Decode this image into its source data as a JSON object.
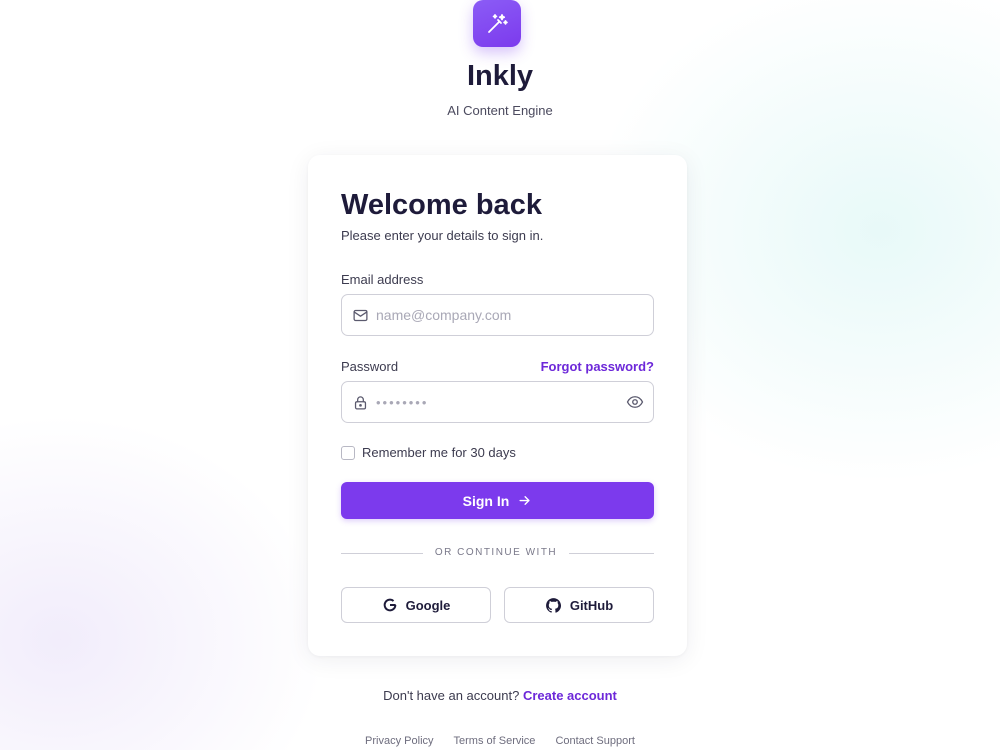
{
  "brand": {
    "name": "Inkly",
    "tagline": "AI Content Engine",
    "logo_icon": "magic-wand-sparkles-icon",
    "accent_color": "#7c3aed"
  },
  "card": {
    "title": "Welcome back",
    "subtitle": "Please enter your details to sign in.",
    "email": {
      "label": "Email address",
      "placeholder": "name@company.com",
      "value": "",
      "icon": "mail-icon"
    },
    "password": {
      "label": "Password",
      "placeholder": "••••••••",
      "value": "",
      "icon": "lock-icon",
      "toggle_icon": "eye-icon",
      "forgot_label": "Forgot password?"
    },
    "remember": {
      "label": "Remember me for 30 days",
      "checked": false
    },
    "submit_label": "Sign In",
    "divider_text": "OR CONTINUE WITH",
    "social": {
      "google_label": "Google",
      "github_label": "GitHub"
    }
  },
  "signup": {
    "prompt": "Don't have an account?",
    "link_label": "Create account"
  },
  "footer": {
    "privacy": "Privacy Policy",
    "terms": "Terms of Service",
    "support": "Contact Support"
  }
}
